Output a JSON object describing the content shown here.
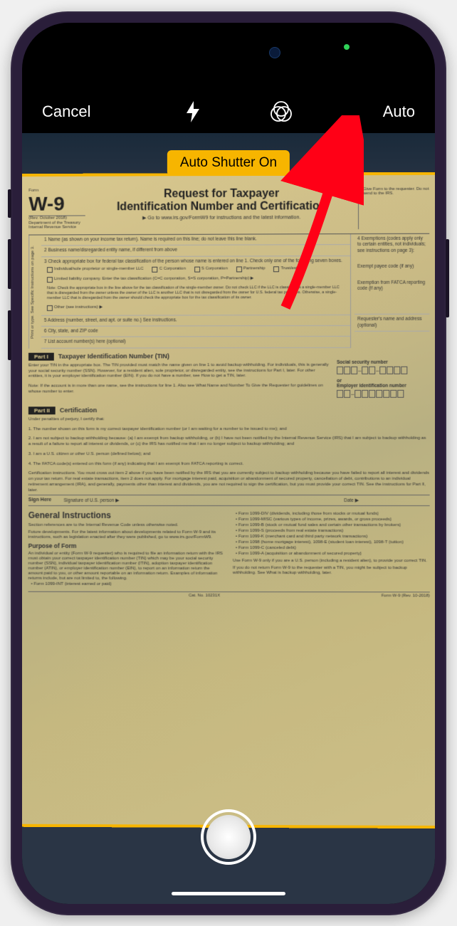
{
  "toolbar": {
    "cancel": "Cancel",
    "auto": "Auto"
  },
  "badge": {
    "auto_shutter": "Auto Shutter On"
  },
  "document": {
    "form_code": "W-9",
    "revision": "(Rev. October 2018)",
    "dept": "Department of the Treasury Internal Revenue Service",
    "title_line1": "Request for Taxpayer",
    "title_line2": "Identification Number and Certification",
    "goto": "▶ Go to www.irs.gov/FormW9 for instructions and the latest information.",
    "giveform": "Give Form to the requester. Do not send to the IRS.",
    "row1": "1 Name (as shown on your income tax return). Name is required on this line; do not leave this line blank.",
    "row2": "2 Business name/disregarded entity name, if different from above",
    "row3": "3 Check appropriate box for federal tax classification of the person whose name is entered on line 1. Check only one of the following seven boxes.",
    "cb1": "Individual/sole proprietor or single-member LLC",
    "cb2": "C Corporation",
    "cb3": "S Corporation",
    "cb4": "Partnership",
    "cb5": "Trust/estate",
    "llc_note": "Limited liability company. Enter the tax classification (C=C corporation, S=S corporation, P=Partnership) ▶",
    "llc_note2": "Note: Check the appropriate box in the line above for the tax classification of the single-member owner. Do not check LLC if the LLC is classified as a single-member LLC that is disregarded from the owner unless the owner of the LLC is another LLC that is not disregarded from the owner for U.S. federal tax purposes. Otherwise, a single-member LLC that is disregarded from the owner should check the appropriate box for the tax classification of its owner.",
    "cb_other": "Other (see instructions) ▶",
    "row4_exempt": "4 Exemptions (codes apply only to certain entities, not individuals; see instructions on page 3):",
    "exempt_payee": "Exempt payee code (if any)",
    "fatca": "Exemption from FATCA reporting code (if any)",
    "row5": "5 Address (number, street, and apt. or suite no.) See instructions.",
    "row5r": "Requester's name and address (optional)",
    "row6": "6 City, state, and ZIP code",
    "row7": "7 List account number(s) here (optional)",
    "vert": "Print or type.  See Specific Instructions on page 3.",
    "part1_label": "Part I",
    "part1_title": "Taxpayer Identification Number (TIN)",
    "part1_text": "Enter your TIN in the appropriate box. The TIN provided must match the name given on line 1 to avoid backup withholding. For individuals, this is generally your social security number (SSN). However, for a resident alien, sole proprietor, or disregarded entity, see the instructions for Part I, later. For other entities, it is your employer identification number (EIN). If you do not have a number, see How to get a TIN, later.",
    "part1_note": "Note: If the account is in more than one name, see the instructions for line 1. Also see What Name and Number To Give the Requester for guidelines on whose number to enter.",
    "ssn_label": "Social security number",
    "or": "or",
    "ein_label": "Employer identification number",
    "part2_label": "Part II",
    "part2_title": "Certification",
    "cert_intro": "Under penalties of perjury, I certify that:",
    "cert1": "1. The number shown on this form is my correct taxpayer identification number (or I am waiting for a number to be issued to me); and",
    "cert2": "2. I am not subject to backup withholding because: (a) I am exempt from backup withholding, or (b) I have not been notified by the Internal Revenue Service (IRS) that I am subject to backup withholding as a result of a failure to report all interest or dividends, or (c) the IRS has notified me that I am no longer subject to backup withholding; and",
    "cert3": "3. I am a U.S. citizen or other U.S. person (defined below); and",
    "cert4": "4. The FATCA code(s) entered on this form (if any) indicating that I am exempt from FATCA reporting is correct.",
    "cert_note": "Certification instructions. You must cross out item 2 above if you have been notified by the IRS that you are currently subject to backup withholding because you have failed to report all interest and dividends on your tax return. For real estate transactions, item 2 does not apply. For mortgage interest paid, acquisition or abandonment of secured property, cancellation of debt, contributions to an individual retirement arrangement (IRA), and generally, payments other than interest and dividends, you are not required to sign the certification, but you must provide your correct TIN. See the instructions for Part II, later.",
    "sign_here": "Sign Here",
    "sig_of": "Signature of U.S. person ▶",
    "date": "Date ▶",
    "gi_title": "General Instructions",
    "gi_ref": "Section references are to the Internal Revenue Code unless otherwise noted.",
    "gi_future": "Future developments. For the latest information about developments related to Form W-9 and its instructions, such as legislation enacted after they were published, go to www.irs.gov/FormW9.",
    "purpose_title": "Purpose of Form",
    "purpose_text": "An individual or entity (Form W-9 requester) who is required to file an information return with the IRS must obtain your correct taxpayer identification number (TIN) which may be your social security number (SSN), individual taxpayer identification number (ITIN), adoption taxpayer identification number (ATIN), or employer identification number (EIN), to report on an information return the amount paid to you, or other amount reportable on an information return. Examples of information returns include, but are not limited to, the following.",
    "b_1099int": "Form 1099-INT (interest earned or paid)",
    "b_1099div": "Form 1099-DIV (dividends, including those from stocks or mutual funds)",
    "b_1099misc": "Form 1099-MISC (various types of income, prizes, awards, or gross proceeds)",
    "b_1099b": "Form 1099-B (stock or mutual fund sales and certain other transactions by brokers)",
    "b_1099s": "Form 1099-S (proceeds from real estate transactions)",
    "b_1099k": "Form 1099-K (merchant card and third party network transactions)",
    "b_1098": "Form 1098 (home mortgage interest), 1098-E (student loan interest), 1098-T (tuition)",
    "b_1099c": "Form 1099-C (canceled debt)",
    "b_1099a": "Form 1099-A (acquisition or abandonment of secured property)",
    "use_w9": "Use Form W-9 only if you are a U.S. person (including a resident alien), to provide your correct TIN.",
    "if_not": "If you do not return Form W-9 to the requester with a TIN, you might be subject to backup withholding. See What is backup withholding, later.",
    "cat_no": "Cat. No. 10231X",
    "form_footer": "Form W-9 (Rev. 10-2018)"
  },
  "colors": {
    "badge_bg": "#f7b500",
    "arrow": "#ff0016"
  }
}
